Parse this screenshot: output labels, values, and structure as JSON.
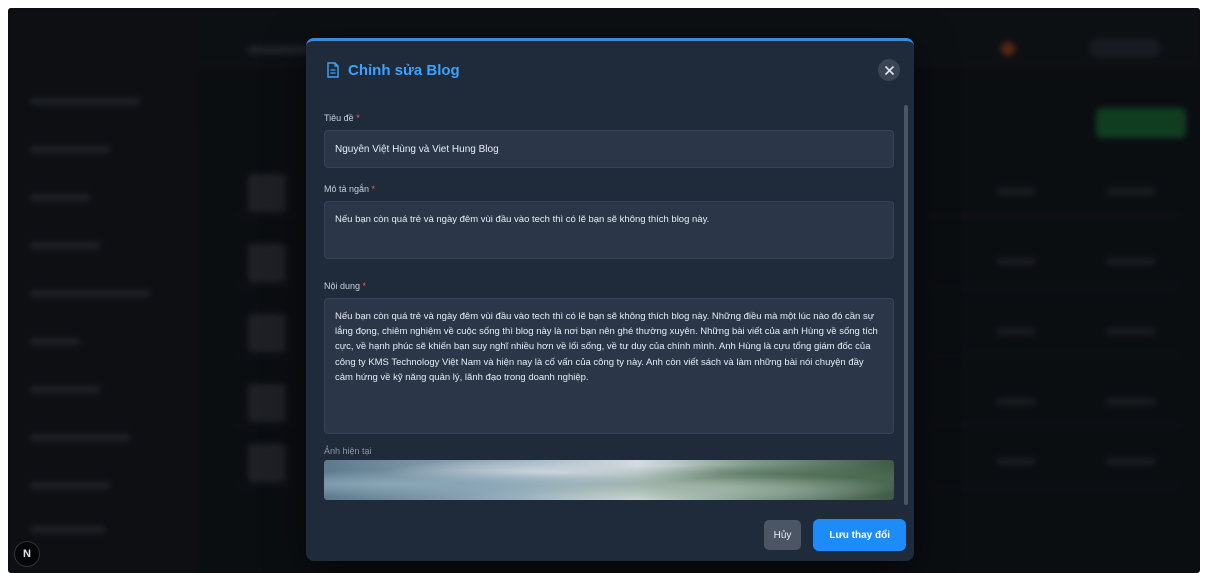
{
  "modal": {
    "title": "Chỉnh sửa Blog",
    "fields": {
      "title": {
        "label": "Tiêu đề",
        "value": "Nguyễn Việt Hùng và Viet Hung Blog"
      },
      "short_description": {
        "label": "Mô tả ngắn",
        "value": "Nếu bạn còn quá trẻ và ngày đêm vùi đầu vào tech thì có lẽ bạn sẽ không thích blog này."
      },
      "content": {
        "label": "Nội dung",
        "value": "Nếu bạn còn quá trẻ và ngày đêm vùi đầu vào tech thì có lẽ bạn sẽ không thích blog này. Những điều mà một lúc nào đó cần sự lắng đọng, chiêm nghiệm về cuộc sống thì blog này là nơi bạn nên ghé thường xuyên. Những bài viết của anh Hùng về sống tích cực, về hạnh phúc sẽ khiến bạn suy nghĩ nhiều hơn về lối sống, về tư duy của chính mình. Anh Hùng là cựu tổng giám đốc của công ty KMS Technology Việt Nam và hiện nay là cố vấn của công ty này. Anh còn viết sách và làm những bài nói chuyện đầy cảm hứng về kỹ năng quản lý, lãnh đạo trong doanh nghiệp."
      },
      "image_preview": {
        "label": "Ảnh hiện tại"
      }
    },
    "required_mark": "*",
    "buttons": {
      "cancel": "Hủy",
      "save": "Lưu thay đổi"
    }
  },
  "badge": {
    "label": "N"
  },
  "colors": {
    "accent": "#3da2ff",
    "save_button": "#1d8cf8",
    "modal_bg": "#1f2a3b"
  }
}
